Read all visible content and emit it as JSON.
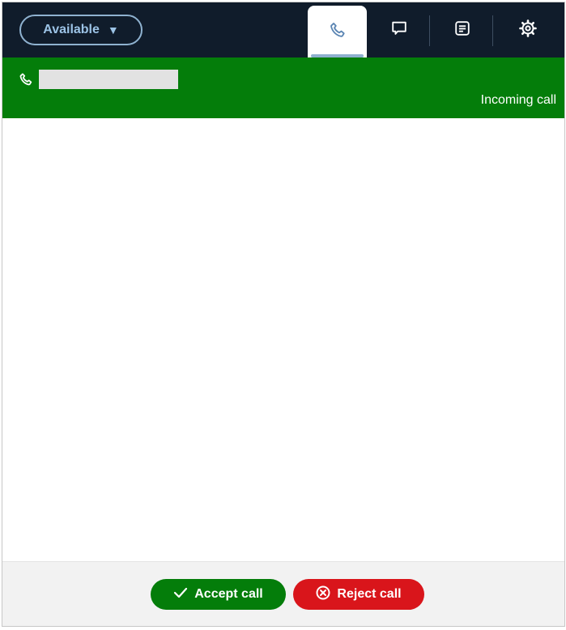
{
  "header": {
    "status_label": "Available",
    "tabs": [
      {
        "name": "Phone",
        "icon": "phone-icon",
        "active": true
      },
      {
        "name": "Chat",
        "icon": "chat-icon",
        "active": false
      },
      {
        "name": "Tasks",
        "icon": "tasks-icon",
        "active": false
      },
      {
        "name": "Settings",
        "icon": "gear-icon",
        "active": false
      }
    ]
  },
  "banner": {
    "status_text": "Incoming call",
    "icon": "phone-icon",
    "color": "#047d0a"
  },
  "footer": {
    "accept_label": "Accept call",
    "reject_label": "Reject call",
    "accept_color": "#047d0a",
    "reject_color": "#d9151b"
  },
  "colors": {
    "topbar": "#101c2b",
    "accent": "#9cc3e6"
  }
}
